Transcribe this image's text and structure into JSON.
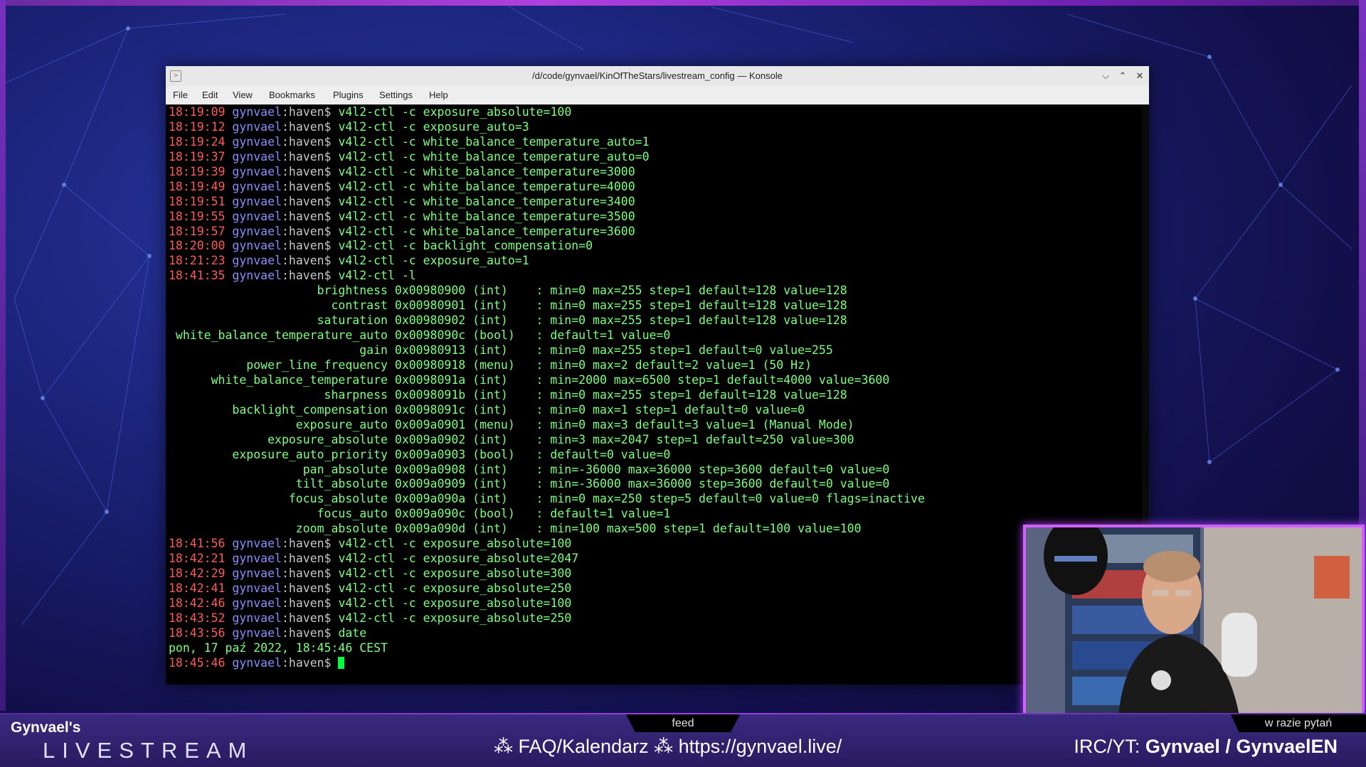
{
  "window": {
    "title": "/d/code/gynvael/KinOfTheStars/livestream_config — Konsole",
    "controls": {
      "minimize": "⌵",
      "maximize": "⌃",
      "close": "✕"
    }
  },
  "menu": [
    "File",
    "Edit",
    "View",
    "Bookmarks",
    "Plugins",
    "Settings",
    "Help"
  ],
  "prompt": {
    "user": "gynvael",
    "sep": ":",
    "host": "haven",
    "symbol": "$ "
  },
  "history": [
    {
      "time": "18:19:09",
      "cmd": "v4l2-ctl -c exposure_absolute=100"
    },
    {
      "time": "18:19:12",
      "cmd": "v4l2-ctl -c exposure_auto=3"
    },
    {
      "time": "18:19:24",
      "cmd": "v4l2-ctl -c white_balance_temperature_auto=1"
    },
    {
      "time": "18:19:37",
      "cmd": "v4l2-ctl -c white_balance_temperature_auto=0"
    },
    {
      "time": "18:19:39",
      "cmd": "v4l2-ctl -c white_balance_temperature=3000"
    },
    {
      "time": "18:19:49",
      "cmd": "v4l2-ctl -c white_balance_temperature=4000"
    },
    {
      "time": "18:19:51",
      "cmd": "v4l2-ctl -c white_balance_temperature=3400"
    },
    {
      "time": "18:19:55",
      "cmd": "v4l2-ctl -c white_balance_temperature=3500"
    },
    {
      "time": "18:19:57",
      "cmd": "v4l2-ctl -c white_balance_temperature=3600"
    },
    {
      "time": "18:20:00",
      "cmd": "v4l2-ctl -c backlight_compensation=0"
    },
    {
      "time": "18:21:23",
      "cmd": "v4l2-ctl -c exposure_auto=1"
    },
    {
      "time": "18:41:35",
      "cmd": "v4l2-ctl -l"
    }
  ],
  "controls_output": [
    "                     brightness 0x00980900 (int)    : min=0 max=255 step=1 default=128 value=128",
    "                       contrast 0x00980901 (int)    : min=0 max=255 step=1 default=128 value=128",
    "                     saturation 0x00980902 (int)    : min=0 max=255 step=1 default=128 value=128",
    " white_balance_temperature_auto 0x0098090c (bool)   : default=1 value=0",
    "                           gain 0x00980913 (int)    : min=0 max=255 step=1 default=0 value=255",
    "           power_line_frequency 0x00980918 (menu)   : min=0 max=2 default=2 value=1 (50 Hz)",
    "      white_balance_temperature 0x0098091a (int)    : min=2000 max=6500 step=1 default=4000 value=3600",
    "                      sharpness 0x0098091b (int)    : min=0 max=255 step=1 default=128 value=128",
    "         backlight_compensation 0x0098091c (int)    : min=0 max=1 step=1 default=0 value=0",
    "                  exposure_auto 0x009a0901 (menu)   : min=0 max=3 default=3 value=1 (Manual Mode)",
    "              exposure_absolute 0x009a0902 (int)    : min=3 max=2047 step=1 default=250 value=300",
    "         exposure_auto_priority 0x009a0903 (bool)   : default=0 value=0",
    "                   pan_absolute 0x009a0908 (int)    : min=-36000 max=36000 step=3600 default=0 value=0",
    "                  tilt_absolute 0x009a0909 (int)    : min=-36000 max=36000 step=3600 default=0 value=0",
    "                 focus_absolute 0x009a090a (int)    : min=0 max=250 step=5 default=0 value=0 flags=inactive",
    "                     focus_auto 0x009a090c (bool)   : default=1 value=1",
    "                  zoom_absolute 0x009a090d (int)    : min=100 max=500 step=1 default=100 value=100"
  ],
  "history2": [
    {
      "time": "18:41:56",
      "cmd": "v4l2-ctl -c exposure_absolute=100"
    },
    {
      "time": "18:42:21",
      "cmd": "v4l2-ctl -c exposure_absolute=2047"
    },
    {
      "time": "18:42:29",
      "cmd": "v4l2-ctl -c exposure_absolute=300"
    },
    {
      "time": "18:42:41",
      "cmd": "v4l2-ctl -c exposure_absolute=250"
    },
    {
      "time": "18:42:46",
      "cmd": "v4l2-ctl -c exposure_absolute=100"
    },
    {
      "time": "18:43:52",
      "cmd": "v4l2-ctl -c exposure_absolute=250"
    },
    {
      "time": "18:43:56",
      "cmd": "date"
    }
  ],
  "date_output": "pon, 17 paź 2022, 18:45:46 CEST",
  "final_prompt_time": "18:45:46",
  "overlay": {
    "feed_tab": "feed",
    "question_tab": "w razie pytań",
    "brand_top": "Gynvael's",
    "brand_main": "LIVESTREAM",
    "faq": "⁂ FAQ/Kalendarz ⁂ https://gynvael.live/",
    "irc_prefix": "IRC/YT: ",
    "irc_names": "Gynvael / GynvaelEN"
  },
  "colors": {
    "timestamp": "#ff5a5a",
    "user": "#8c8cff",
    "host": "#c8c8c8",
    "command": "#7cff7c",
    "accent": "#b040e0"
  }
}
